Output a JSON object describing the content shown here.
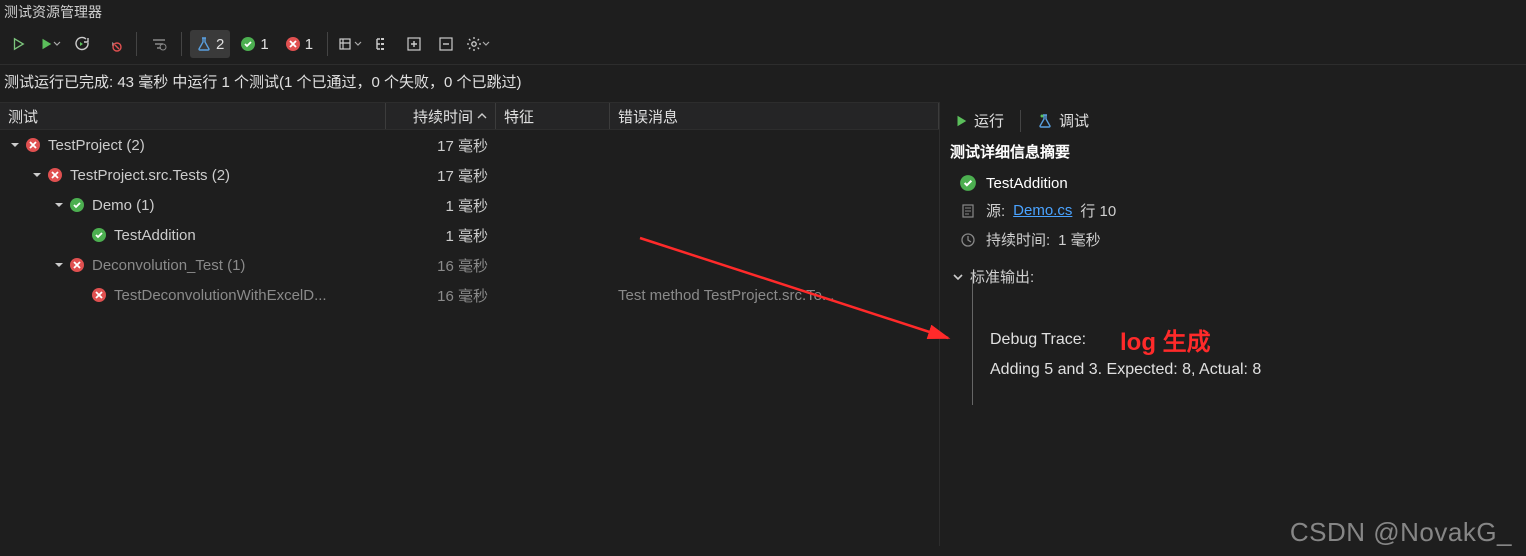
{
  "window": {
    "title": "测试资源管理器"
  },
  "toolbar": {
    "flask_count": "2",
    "pass_count": "1",
    "fail_count": "1"
  },
  "status_line": "测试运行已完成: 43 毫秒 中运行 1 个测试(1 个已通过，0 个失败，0 个已跳过)",
  "columns": {
    "test": "测试",
    "duration": "持续时间",
    "traits": "特征",
    "error": "错误消息"
  },
  "tree": [
    {
      "indent": 0,
      "expander": true,
      "status": "fail",
      "name": "TestProject (2)",
      "duration": "17 毫秒",
      "dim": false
    },
    {
      "indent": 1,
      "expander": true,
      "status": "fail",
      "name": "TestProject.src.Tests (2)",
      "duration": "17 毫秒",
      "dim": false
    },
    {
      "indent": 2,
      "expander": true,
      "status": "pass",
      "name": "Demo (1)",
      "duration": "1 毫秒",
      "dim": false
    },
    {
      "indent": 3,
      "expander": false,
      "status": "pass",
      "name": "TestAddition",
      "duration": "1 毫秒",
      "dim": false
    },
    {
      "indent": 2,
      "expander": true,
      "status": "fail",
      "name": "Deconvolution_Test (1)",
      "duration": "16 毫秒",
      "dim": true
    },
    {
      "indent": 3,
      "expander": false,
      "status": "fail",
      "name": "TestDeconvolutionWithExcelD...",
      "duration": "16 毫秒",
      "dim": true,
      "error": "Test method TestProject.src.Te..."
    }
  ],
  "detail": {
    "run": "运行",
    "debug": "调试",
    "summary_title": "测试详细信息摘要",
    "test_name": "TestAddition",
    "source_label": "源:",
    "source_file": "Demo.cs",
    "source_line": "行  10",
    "duration_label": "持续时间:",
    "duration_value": "1 毫秒",
    "std_out": "标准输出:",
    "annotation": "log 生成",
    "trace_title": "Debug Trace:",
    "trace_body": "Adding 5 and 3. Expected: 8, Actual: 8"
  },
  "watermark": "CSDN @NovakG_"
}
